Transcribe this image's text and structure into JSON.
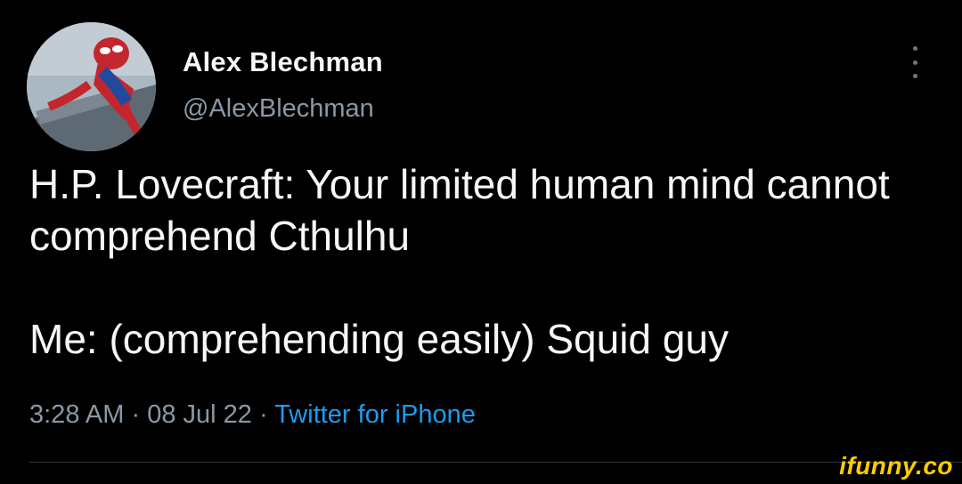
{
  "tweet": {
    "author": {
      "display_name": "Alex Blechman",
      "handle": "@AlexBlechman",
      "avatar_icon": "spiderman-avatar"
    },
    "text_lines": [
      "H.P. Lovecraft: Your limited human mind cannot comprehend Cthulhu",
      "Me: (comprehending easily) Squid guy"
    ],
    "time": "3:28 AM",
    "separator1": "·",
    "date": "08 Jul 22",
    "separator2": "·",
    "source": "Twitter for iPhone"
  },
  "watermark": {
    "text": "ifunny.co",
    "color": "#ffcc00"
  },
  "colors": {
    "background": "#000000",
    "text": "#f5f7f8",
    "secondary": "#8b98a5",
    "link": "#1d9bf0"
  }
}
